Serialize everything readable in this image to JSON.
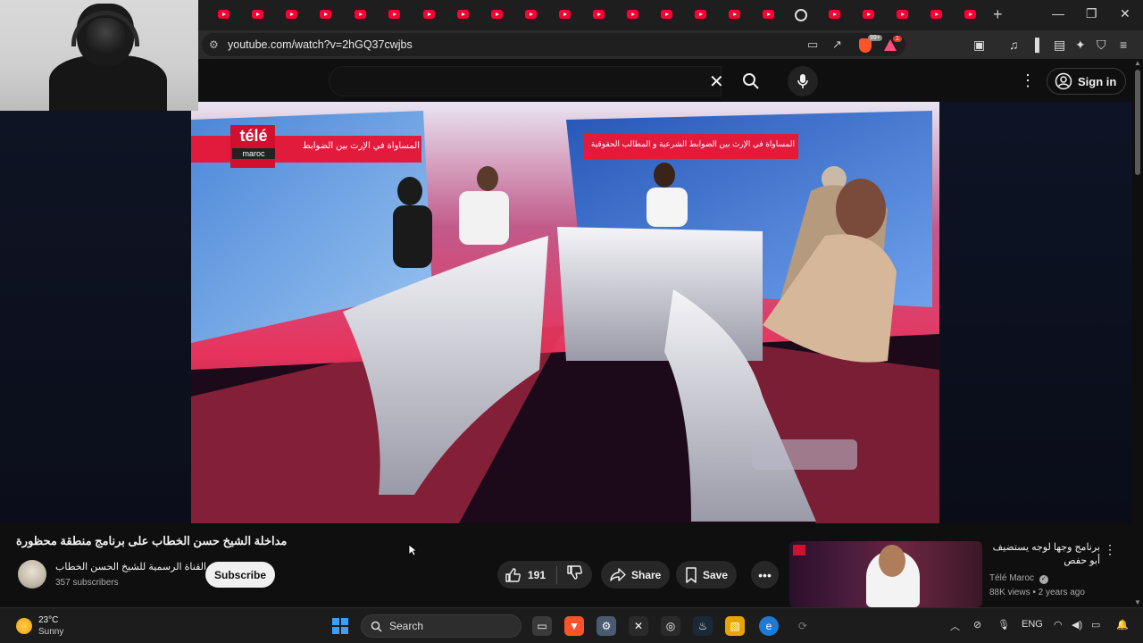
{
  "browser": {
    "url": "youtube.com/watch?v=2hGQ37cwjbs",
    "brave_badge": "99+",
    "rewards_badge": "1"
  },
  "masthead": {
    "search_placeholder": "",
    "sign_in_label": "Sign in"
  },
  "video": {
    "title": "مداخلة الشيخ حسن الخطاب على برنامج منطقة محظورة",
    "channel_name": "القناة الرسمية للشيخ الحسن الخطاب",
    "subscribers": "357 subscribers",
    "subscribe_label": "Subscribe",
    "likes": "191",
    "share_label": "Share",
    "save_label": "Save",
    "player_logo_brand": "télé",
    "player_logo_sub": "maroc",
    "banner_text_left": "المساواة في الإرث بين الضوابط",
    "banner_text_right": "المساواة في الإرث بين الضوابط الشرعية و المطالب الحقوقية"
  },
  "recommendation": {
    "title": "برنامج وجها لوجه يستضيف أبو حفص",
    "channel": "Télé Maroc",
    "views": "88K views",
    "age": "2 years ago"
  },
  "taskbar": {
    "temperature": "23°C",
    "condition": "Sunny",
    "search_label": "Search",
    "language": "ENG"
  }
}
